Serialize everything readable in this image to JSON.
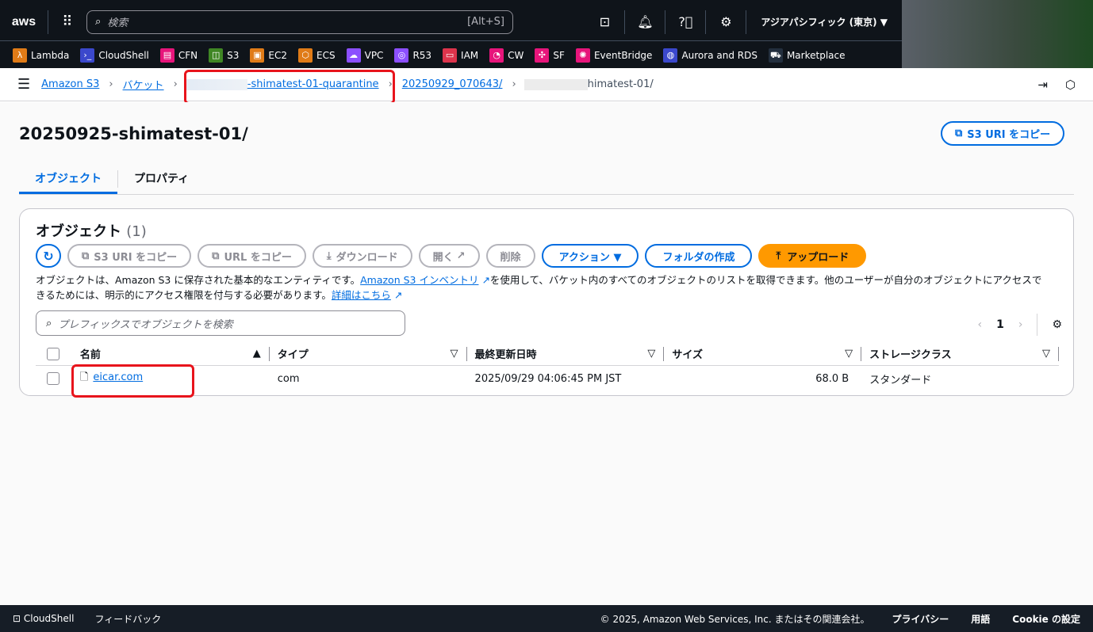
{
  "nav": {
    "logo": "aws",
    "search_placeholder": "検索",
    "search_shortcut": "[Alt+S]",
    "region": "アジアパシフィック (東京) ▼"
  },
  "favorites": [
    {
      "label": "Lambda",
      "color": "#e07b17",
      "glyph": "λ"
    },
    {
      "label": "CloudShell",
      "color": "#3b48cc",
      "glyph": "›_"
    },
    {
      "label": "CFN",
      "color": "#e7157b",
      "glyph": "▤"
    },
    {
      "label": "S3",
      "color": "#3f8624",
      "glyph": "◫"
    },
    {
      "label": "EC2",
      "color": "#e07b17",
      "glyph": "▣"
    },
    {
      "label": "ECS",
      "color": "#e07b17",
      "glyph": "⬡"
    },
    {
      "label": "VPC",
      "color": "#8c4fff",
      "glyph": "☁"
    },
    {
      "label": "R53",
      "color": "#8c4fff",
      "glyph": "◎"
    },
    {
      "label": "IAM",
      "color": "#dd344c",
      "glyph": "▭"
    },
    {
      "label": "CW",
      "color": "#e7157b",
      "glyph": "◔"
    },
    {
      "label": "SF",
      "color": "#e7157b",
      "glyph": "✣"
    },
    {
      "label": "EventBridge",
      "color": "#e7157b",
      "glyph": "✺"
    },
    {
      "label": "Aurora and RDS",
      "color": "#3b48cc",
      "glyph": "◍"
    },
    {
      "label": "Marketplace",
      "color": "#232f3e",
      "glyph": "⛟"
    }
  ],
  "breadcrumb": {
    "items": [
      "Amazon S3",
      "バケット",
      "-shimatest-01-quarantine",
      "20250929_070643/"
    ],
    "current": "himatest-01/"
  },
  "page": {
    "title": "20250925-shimatest-01/",
    "copy_uri": "S3 URI をコピー",
    "tabs": [
      "オブジェクト",
      "プロパティ"
    ]
  },
  "objects": {
    "title": "オブジェクト",
    "count": "(1)",
    "buttons": {
      "copy_uri": "S3 URI をコピー",
      "copy_url": "URL をコピー",
      "download": "ダウンロード",
      "open": "開く",
      "delete": "削除",
      "actions": "アクション ▼",
      "create_folder": "フォルダの作成",
      "upload": "アップロード"
    },
    "desc1": "オブジェクトは、Amazon S3 に保存された基本的なエンティティです。",
    "desc_link1": "Amazon S3 インベントリ",
    "desc2": "を使用して、バケット内のすべてのオブジェクトのリストを取得できます。他のユーザーが自分のオブジェクトにアクセスできるためには、明示的にアクセス権限を付与する必要があります。",
    "desc_link2": "詳細はこちら",
    "search_placeholder": "プレフィックスでオブジェクトを検索",
    "page": "1",
    "columns": [
      "名前",
      "タイプ",
      "最終更新日時",
      "サイズ",
      "ストレージクラス"
    ],
    "rows": [
      {
        "name": "eicar.com",
        "type": "com",
        "modified": "2025/09/29 04:06:45 PM JST",
        "size": "68.0 B",
        "storage": "スタンダード"
      }
    ]
  },
  "footer": {
    "cloudshell": "CloudShell",
    "feedback": "フィードバック",
    "copyright": "© 2025, Amazon Web Services, Inc. またはその関連会社。",
    "privacy": "プライバシー",
    "terms": "用語",
    "cookie": "Cookie の設定"
  }
}
